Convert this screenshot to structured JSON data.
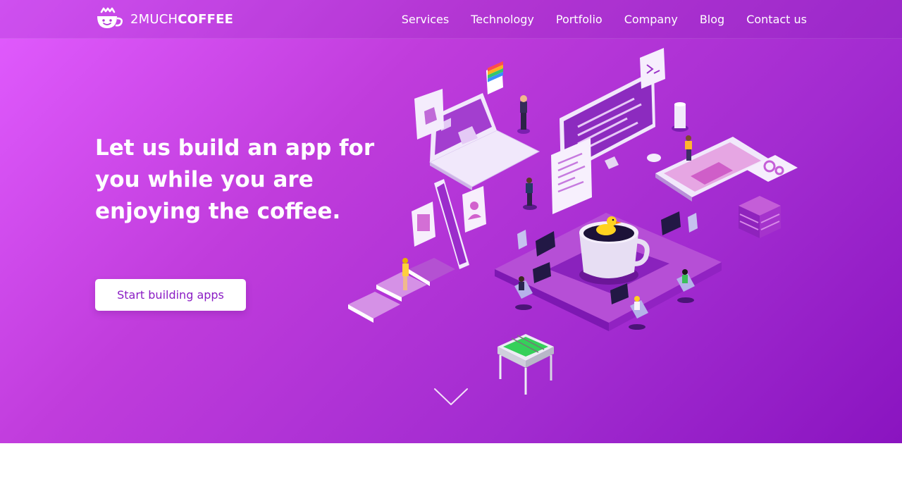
{
  "brand": {
    "name_regular": "2MUCH",
    "name_bold": "COFFEE",
    "logo_icon": "coffee-cup-face-icon"
  },
  "nav": {
    "items": [
      {
        "label": "Services"
      },
      {
        "label": "Technology"
      },
      {
        "label": "Portfolio"
      },
      {
        "label": "Company"
      },
      {
        "label": "Blog"
      },
      {
        "label": "Contact us"
      }
    ]
  },
  "hero": {
    "headline": "Let us build an app for you while you are enjoying the coffee.",
    "cta_label": "Start building apps",
    "scroll_icon": "chevron-down-icon"
  },
  "colors": {
    "gradient_start": "#e25cff",
    "gradient_end": "#8a14c0",
    "accent_text": "#8a1cc4",
    "white": "#ffffff"
  }
}
